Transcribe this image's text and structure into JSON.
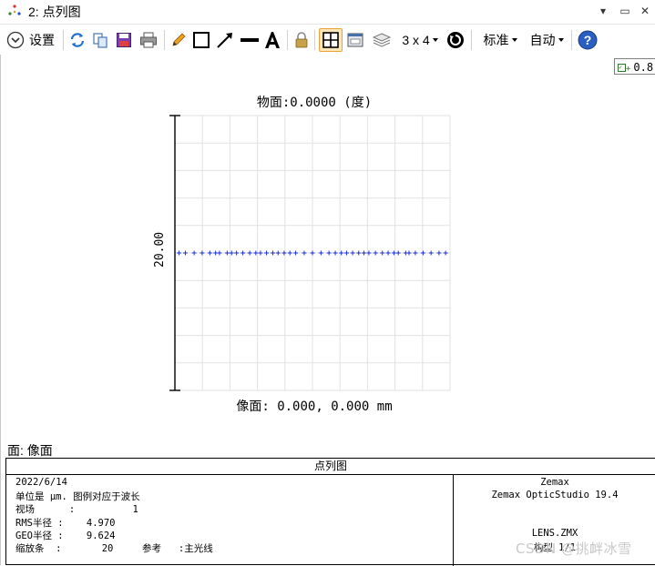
{
  "window": {
    "title": "2: 点列图",
    "pin_glyph": "▾",
    "restore_glyph": "▭",
    "close_glyph": "✕"
  },
  "toolbar": {
    "settings_label": "设置",
    "layout_label": "3 x 4",
    "standard_label": "标准",
    "auto_label": "自动"
  },
  "field_selector": {
    "value": "0.8"
  },
  "plot": {
    "title": "物面:0.0000 (度)",
    "image_plane_label": "像面: 0.000, 0.000 mm",
    "scale_bar_label": "20.00"
  },
  "chart_data": {
    "type": "scatter",
    "title": "物面:0.0000 (度)",
    "xlabel": "像面: 0.000, 0.000 mm",
    "ylabel": "",
    "scale_bar": 20.0,
    "xlim": [
      -50,
      50
    ],
    "ylim": [
      -50,
      50
    ],
    "grid": true,
    "series": [
      {
        "color": "#1a2fd6",
        "marker": "+",
        "x": [
          -48.5,
          -46.2,
          -43.0,
          -40.1,
          -37.3,
          -35.2,
          -33.8,
          -31.0,
          -29.4,
          -27.6,
          -25.3,
          -22.8,
          -20.6,
          -18.9,
          -16.7,
          -14.4,
          -12.5,
          -10.3,
          -8.2,
          -6.1,
          -3.0,
          0.0,
          3.1,
          6.0,
          8.3,
          10.5,
          12.4,
          14.6,
          16.8,
          18.7,
          20.5,
          22.9,
          25.4,
          27.5,
          29.6,
          31.2,
          33.9,
          35.1,
          37.4,
          40.2,
          43.1,
          46.0,
          48.4
        ],
        "y": [
          0,
          0,
          0,
          0,
          0,
          0,
          0,
          0,
          0,
          0,
          0,
          0,
          0,
          0,
          0,
          0,
          0,
          0,
          0,
          0,
          0,
          0,
          0,
          0,
          0,
          0,
          0,
          0,
          0,
          0,
          0,
          0,
          0,
          0,
          0,
          0,
          0,
          0,
          0,
          0,
          0,
          0,
          0
        ]
      }
    ]
  },
  "surface": {
    "label": "面: 像面"
  },
  "footer": {
    "title": "点列图",
    "date": "2022/6/14",
    "units_line": "单位是 μm. 图例对应于波长",
    "field_line": "视场      :          1",
    "rms_line": "RMS半径 :    4.970",
    "geo_line": "GEO半径 :    9.624",
    "scale_line": "缩放条  :       20     参考   :主光线",
    "vendor": "Zemax",
    "product": "Zemax OpticStudio 19.4",
    "file": "LENS.ZMX",
    "config": "构型 1/1"
  },
  "watermark": "CSDN @挑衅冰雪",
  "colors": {
    "spot": "#1a2fd6",
    "grid": "#e2e2e2",
    "accent_active": "#e8a33a"
  }
}
